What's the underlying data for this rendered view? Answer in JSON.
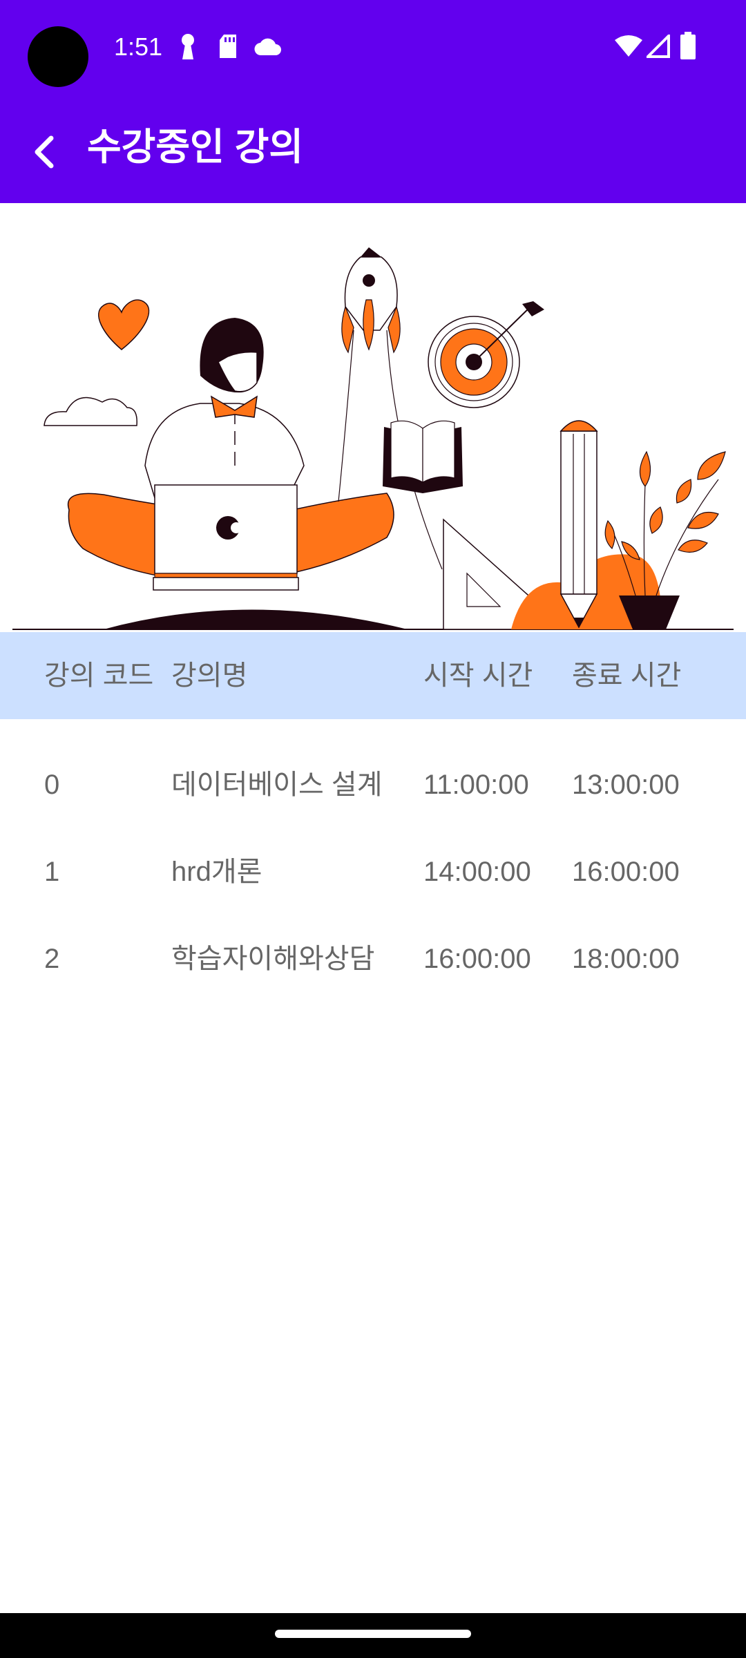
{
  "status_bar": {
    "time": "1:51",
    "notification_icons": [
      "keyhole-icon",
      "sd-card-icon",
      "cloud-icon"
    ],
    "system_icons": [
      "wifi-icon",
      "signal-icon",
      "battery-icon"
    ]
  },
  "app_bar": {
    "title": "수강중인 강의",
    "back_icon": "arrow-back-icon"
  },
  "table": {
    "headers": {
      "code": "강의 코드",
      "name": "강의명",
      "start": "시작 시간",
      "end": "종료 시간"
    },
    "rows": [
      {
        "code": "0",
        "name": "데이터베이스 설계",
        "start": "11:00:00",
        "end": "13:00:00"
      },
      {
        "code": "1",
        "name": "hrd개론",
        "start": "14:00:00",
        "end": "16:00:00"
      },
      {
        "code": "2",
        "name": "학습자이해와상담",
        "start": "16:00:00",
        "end": "18:00:00"
      }
    ]
  },
  "colors": {
    "primary": "#6200EE",
    "header_bg": "#CCE0FF",
    "accent_orange": "#FF7418",
    "dark": "#1F0710",
    "text_gray": "#666666"
  }
}
